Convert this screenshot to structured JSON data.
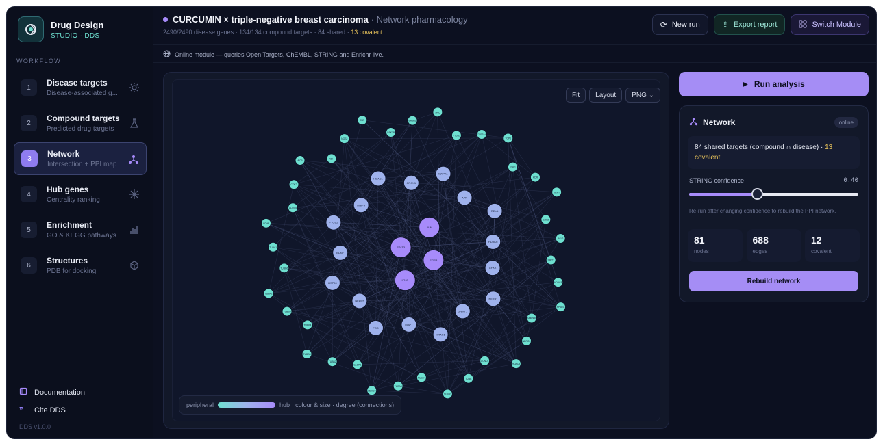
{
  "brand": {
    "title": "Drug Design",
    "subtitle": "STUDIO · DDS"
  },
  "sidebar": {
    "section_label": "WORKFLOW",
    "steps": [
      {
        "num": "1",
        "title": "Disease targets",
        "sub": "Disease-associated g...",
        "icon": "sun-icon"
      },
      {
        "num": "2",
        "title": "Compound targets",
        "sub": "Predicted drug targets",
        "icon": "flask-icon"
      },
      {
        "num": "3",
        "title": "Network",
        "sub": "Intersection + PPI map",
        "icon": "network-icon",
        "active": true
      },
      {
        "num": "4",
        "title": "Hub genes",
        "sub": "Centrality ranking",
        "icon": "snowflake-icon"
      },
      {
        "num": "5",
        "title": "Enrichment",
        "sub": "GO & KEGG pathways",
        "icon": "bar-chart-icon"
      },
      {
        "num": "6",
        "title": "Structures",
        "sub": "PDB for docking",
        "icon": "cube-icon"
      }
    ],
    "footer_links": [
      {
        "label": "Documentation",
        "icon": "book-icon"
      },
      {
        "label": "Cite DDS",
        "icon": "quote-icon"
      }
    ],
    "version": "DDS v1.0.0"
  },
  "header": {
    "title": "CURCUMIN × triple-negative breast carcinoma",
    "title_suffix": "· Network pharmacology",
    "subtitle": "2490/2490 disease genes · 134/134 compound targets · 84 shared ·",
    "subtitle_covalent": "13 covalent",
    "buttons": {
      "new_run": "New run",
      "export": "Export report",
      "switch": "Switch Module"
    }
  },
  "banner": {
    "text": "Online module — queries Open Targets, ChEMBL, STRING and Enrichr live."
  },
  "graph": {
    "tools": {
      "fit": "Fit",
      "layout": "Layout",
      "png": "PNG ⌄"
    },
    "legend": {
      "left": "peripheral",
      "right": "hub",
      "note": "colour & size · degree (connections)"
    },
    "nodes": [
      [
        "EGFR",
        3
      ],
      [
        "IFNG",
        3
      ],
      [
        "STAT3",
        3
      ],
      [
        "JUN",
        3
      ],
      [
        "CFXX",
        2
      ],
      [
        "NFKB1",
        2
      ],
      [
        "DNMT1",
        2
      ],
      [
        "HRAS1",
        2
      ],
      [
        "MAPT",
        2
      ],
      [
        "FOS",
        2
      ],
      [
        "NFKB2",
        2
      ],
      [
        "HSP90",
        2
      ],
      [
        "BDNF",
        2
      ],
      [
        "PTGS2",
        2
      ],
      [
        "MMP9",
        2
      ],
      [
        "HDAC1",
        2
      ],
      [
        "CRCX1",
        2
      ],
      [
        "MAPK1",
        2
      ],
      [
        "APP",
        2
      ],
      [
        "RELA",
        2
      ],
      [
        "HDAC6",
        2
      ],
      [
        "SIRT1",
        1
      ],
      [
        "HDAC8",
        1
      ],
      [
        "PPARG",
        1
      ],
      [
        "MAPK8",
        1
      ],
      [
        "NDRG1",
        1
      ],
      [
        "HDAC9",
        1
      ],
      [
        "CCND1",
        1
      ],
      [
        "TUBB",
        1
      ],
      [
        "TUBB1",
        1
      ],
      [
        "TUBA4",
        1
      ],
      [
        "TUBA3",
        1
      ],
      [
        "HDAC7",
        1
      ],
      [
        "CASP3",
        1
      ],
      [
        "TUBB2",
        1
      ],
      [
        "TUBB3",
        1
      ],
      [
        "TUBB4",
        1
      ],
      [
        "TUBB5",
        1
      ],
      [
        "TUBA2",
        1
      ],
      [
        "TUBB6",
        1
      ],
      [
        "TUBA1",
        1
      ],
      [
        "ACHE",
        1
      ],
      [
        "ALOX5",
        1
      ],
      [
        "CDK2",
        1
      ],
      [
        "ABCB1",
        1
      ],
      [
        "XDH",
        1
      ],
      [
        "NOS2",
        1
      ],
      [
        "CAT",
        1
      ],
      [
        "GSK3B",
        1
      ],
      [
        "ERBB2",
        1
      ],
      [
        "SRC",
        1
      ],
      [
        "PTGS1",
        1
      ],
      [
        "CYP3A4",
        1
      ],
      [
        "TOP1",
        1
      ],
      [
        "ESR1",
        1
      ],
      [
        "KDR",
        1
      ],
      [
        "TERT",
        1
      ],
      [
        "EZH2",
        1
      ],
      [
        "BCL2",
        1
      ]
    ]
  },
  "panel": {
    "run_label": "Run analysis",
    "network_title": "Network",
    "online_badge": "online",
    "shared_text": "84 shared targets (compound ∩ disease) ·",
    "shared_covalent": "13 covalent",
    "confidence_label": "STRING confidence",
    "confidence_value": "0.40",
    "confidence": 0.4,
    "note": "Re-run after changing confidence to rebuild the PPI network.",
    "stats": [
      {
        "value": "81",
        "label": "nodes"
      },
      {
        "value": "688",
        "label": "edges"
      },
      {
        "value": "12",
        "label": "covalent"
      }
    ],
    "rebuild_label": "Rebuild network"
  },
  "colors": {
    "accent": "#a78bfa",
    "teal": "#6ee0d0",
    "warn": "#e8c35b"
  }
}
